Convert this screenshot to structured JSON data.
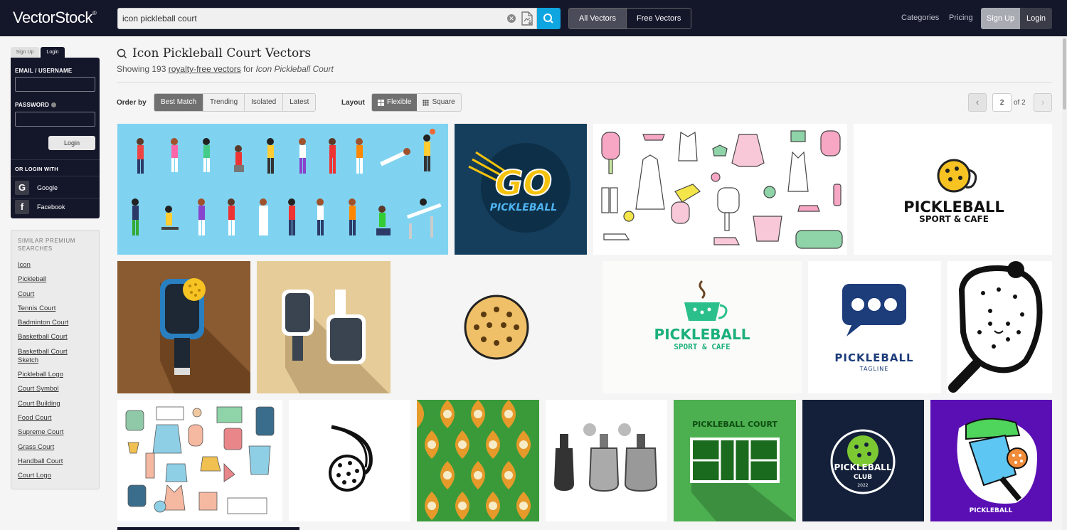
{
  "header": {
    "logo": "VectorStock",
    "logo_mark": "®",
    "search_value": "icon pickleball court",
    "filters": [
      "All Vectors",
      "Free Vectors"
    ],
    "nav": [
      "Categories",
      "Pricing"
    ],
    "signup": "Sign Up",
    "login": "Login"
  },
  "login_box": {
    "tabs": [
      "Sign Up",
      "Login"
    ],
    "email_label": "EMAIL / USERNAME",
    "password_label": "PASSWORD",
    "login_button": "Login",
    "or_login_with": "OR LOGIN WITH",
    "social": [
      {
        "icon": "G",
        "label": "Google"
      },
      {
        "icon": "f",
        "label": "Facebook"
      }
    ]
  },
  "similar": {
    "title": "SIMILAR PREMIUM SEARCHES",
    "items": [
      "Icon",
      "Pickleball",
      "Court",
      "Tennis Court",
      "Badminton Court",
      "Basketball Court",
      "Basketball Court Sketch",
      "Pickleball Logo",
      "Court Symbol",
      "Court Building",
      "Food Court",
      "Supreme Court",
      "Grass Court",
      "Handball Court",
      "Court Logo"
    ]
  },
  "results": {
    "title": "Icon Pickleball Court Vectors",
    "showing_prefix": "Showing 193 ",
    "showing_link": "royalty-free vectors",
    "showing_mid": " for ",
    "showing_query": "Icon Pickleball Court"
  },
  "toolbar": {
    "order_label": "Order by",
    "order_options": [
      "Best Match",
      "Trending",
      "Isolated",
      "Latest"
    ],
    "layout_label": "Layout",
    "layout_options": [
      "Flexible",
      "Square"
    ],
    "page": "2",
    "of_pages": "of 2"
  },
  "thumbnails": {
    "go_text": "GO",
    "go_sub": "PICKLEBALL",
    "pb_cafe_1": "PICKLEBALL",
    "pb_cafe_1_sub": "SPORT & CAFE",
    "pb_cafe_2": "PICKLEBALL",
    "pb_cafe_2_sub": "SPORT & CAFE",
    "pb_tag": "PICKLEBALL",
    "pb_tag_sub": "TAGLINE",
    "court_text": "PICKLEBALL COURT",
    "club_text": "PICKLEBALL",
    "club_sub": "CLUB",
    "club_year": "2022",
    "purple_text": "PICKLEBALL"
  },
  "colors": {
    "topbar": "#14162a",
    "accent": "#0fa5e0",
    "court_green": "#4caf50",
    "purple": "#5a0fb4"
  }
}
